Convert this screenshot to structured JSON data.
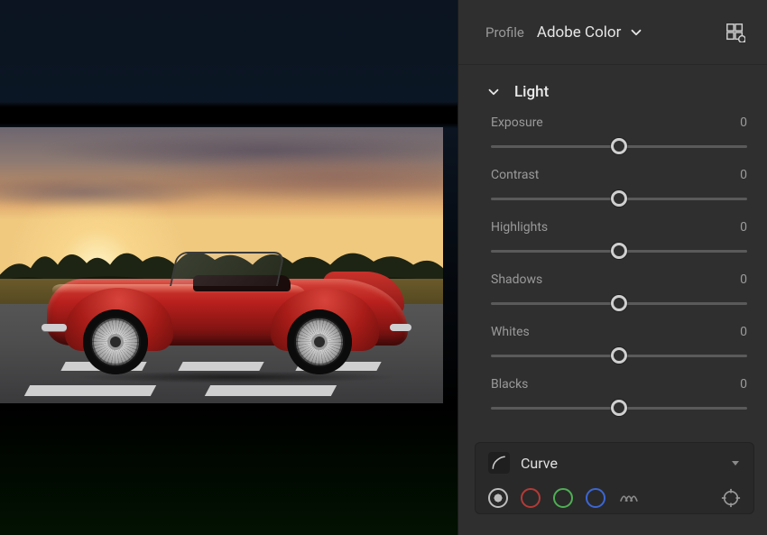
{
  "profile": {
    "label": "Profile",
    "value": "Adobe Color"
  },
  "sections": {
    "light": {
      "title": "Light",
      "sliders": {
        "exposure": {
          "label": "Exposure",
          "value": "0",
          "pos": 50
        },
        "contrast": {
          "label": "Contrast",
          "value": "0",
          "pos": 50
        },
        "highlights": {
          "label": "Highlights",
          "value": "0",
          "pos": 50
        },
        "shadows": {
          "label": "Shadows",
          "value": "0",
          "pos": 50
        },
        "whites": {
          "label": "Whites",
          "value": "0",
          "pos": 50
        },
        "blacks": {
          "label": "Blacks",
          "value": "0",
          "pos": 50
        }
      }
    },
    "curve": {
      "title": "Curve",
      "channels": {
        "parametric_color": "#bdbdbd",
        "red": "#b43a37",
        "green": "#4fae53",
        "blue": "#3b66d4"
      }
    }
  }
}
